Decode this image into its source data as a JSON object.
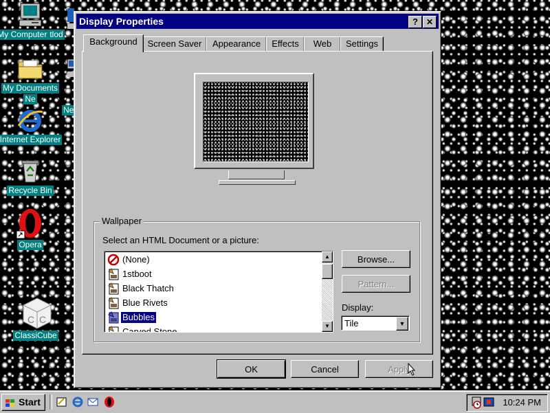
{
  "desktop": {
    "icons": [
      {
        "label": "My Computer",
        "overlap": "tlod",
        "icon": "computer-icon"
      },
      {
        "label": "My Documents",
        "overlap": "Ne",
        "extra": "Neigh",
        "icon": "folder-documents-icon"
      },
      {
        "label": "Internet Explorer",
        "icon": "internet-explorer-icon"
      },
      {
        "label": "Recycle Bin",
        "icon": "recycle-bin-icon"
      },
      {
        "label": "Opera",
        "icon": "opera-icon"
      },
      {
        "label": "ClassiCube",
        "icon": "classicube-icon"
      }
    ]
  },
  "window": {
    "title": "Display Properties",
    "help_label": "?",
    "close_label": "✕",
    "tabs": [
      "Background",
      "Screen Saver",
      "Appearance",
      "Effects",
      "Web",
      "Settings"
    ],
    "active_tab": "Background",
    "wallpaper": {
      "group_label": "Wallpaper",
      "prompt": "Select an HTML Document or a picture:",
      "items": [
        "(None)",
        "1stboot",
        "Black Thatch",
        "Blue Rivets",
        "Bubbles",
        "Carved Stone"
      ],
      "selected": "Bubbles",
      "browse_label": "Browse...",
      "pattern_label": "Pattern...",
      "display_label": "Display:",
      "display_value": "Tile"
    },
    "buttons": {
      "ok": "OK",
      "cancel": "Cancel",
      "apply": "Apply"
    }
  },
  "taskbar": {
    "start_label": "Start",
    "quicklaunch": [
      "show-desktop-icon",
      "internet-explorer-icon",
      "outlook-express-icon",
      "opera-icon"
    ],
    "clock": "10:24 PM"
  },
  "colors": {
    "window_face": "#c0c0c0",
    "title_bar": "#000080",
    "selection": "#000080",
    "desktop_label_bg": "#008080"
  }
}
